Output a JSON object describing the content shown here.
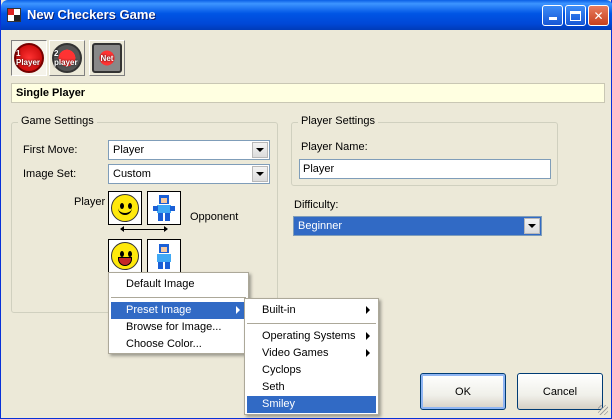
{
  "window": {
    "title": "New Checkers Game",
    "buttons": {
      "minimize": "minimize-icon",
      "maximize": "maximize-icon",
      "close": "close-icon"
    }
  },
  "toolbar": {
    "one_player_label": "1 Player",
    "two_player_label": "2 player",
    "net_label": "Net"
  },
  "mode_bar": {
    "text": "Single Player"
  },
  "game_settings": {
    "legend": "Game Settings",
    "first_move": {
      "label": "First Move:",
      "value": "Player"
    },
    "image_set": {
      "label": "Image Set:",
      "value": "Custom"
    },
    "player_label": "Player",
    "opponent_label": "Opponent"
  },
  "player_settings": {
    "legend": "Player Settings",
    "name_label": "Player Name:",
    "name_value": "Player"
  },
  "difficulty": {
    "label": "Difficulty:",
    "value": "Beginner"
  },
  "context_menu": {
    "items": [
      "Default Image",
      "Preset Image",
      "Browse for Image...",
      "Choose Color..."
    ]
  },
  "preset_submenu": {
    "items": [
      "Built-in",
      "Operating Systems",
      "Video Games",
      "Cyclops",
      "Seth",
      "Smiley"
    ]
  },
  "buttons": {
    "ok": "OK",
    "cancel": "Cancel"
  },
  "colors": {
    "title_blue": "#0055E5",
    "menu_highlight": "#316AC5",
    "info_bar": "#FFFFE1"
  }
}
